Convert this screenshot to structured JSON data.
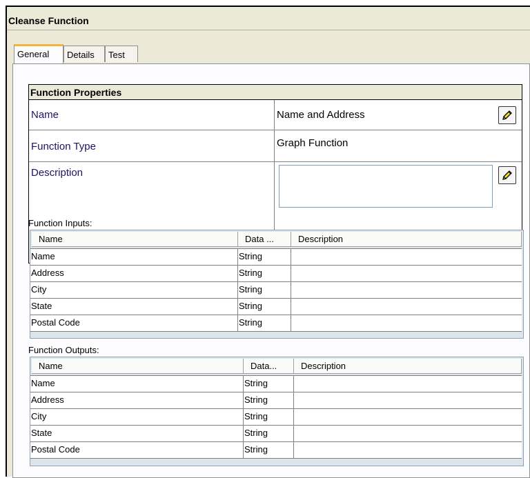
{
  "window": {
    "title": "Cleanse Function"
  },
  "tabs": [
    {
      "label": "General",
      "active": true
    },
    {
      "label": "Details",
      "active": false
    },
    {
      "label": "Test",
      "active": false
    }
  ],
  "properties": {
    "header": "Function Properties",
    "rows": {
      "name": {
        "label": "Name",
        "value": "Name and Address",
        "editable": true
      },
      "type": {
        "label": "Function Type",
        "value": "Graph Function",
        "editable": false
      },
      "description": {
        "label": "Description",
        "value": "",
        "editable": true
      }
    }
  },
  "inputs": {
    "label": "Function Inputs:",
    "columns": [
      "Name",
      "Data ...",
      "Description"
    ],
    "rows": [
      [
        "Name",
        "String",
        ""
      ],
      [
        "Address",
        "String",
        ""
      ],
      [
        "City",
        "String",
        ""
      ],
      [
        "State",
        "String",
        ""
      ],
      [
        "Postal Code",
        "String",
        ""
      ]
    ]
  },
  "outputs": {
    "label": "Function Outputs:",
    "columns": [
      "Name",
      "Data...",
      "Description"
    ],
    "rows": [
      [
        "Name",
        "String",
        ""
      ],
      [
        "Address",
        "String",
        ""
      ],
      [
        "City",
        "String",
        ""
      ],
      [
        "State",
        "String",
        ""
      ],
      [
        "Postal Code",
        "String",
        ""
      ]
    ]
  },
  "colors": {
    "window_bg": "#ece9d8",
    "active_tab_accent": "#f5b43d",
    "label_text": "#1b1464",
    "grid_border": "#8fa3b8"
  },
  "icons": {
    "edit": "pencil-icon"
  }
}
